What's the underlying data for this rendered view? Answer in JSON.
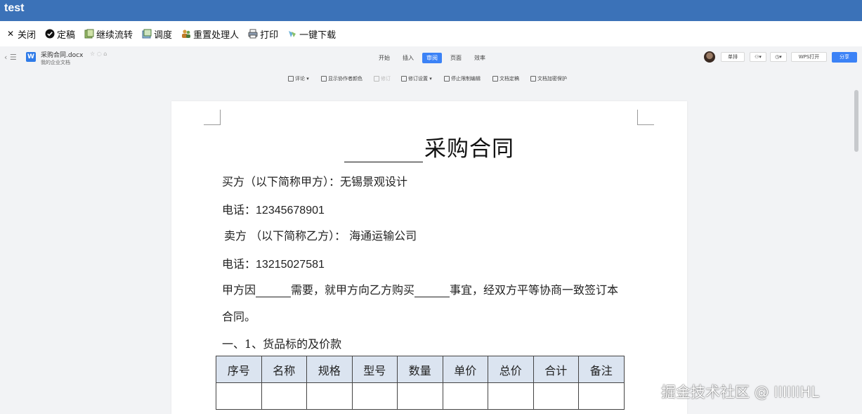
{
  "app": {
    "title": "test"
  },
  "toolbar": {
    "close": "关闭",
    "finalize": "定稿",
    "continue_flow": "继续流转",
    "dispatch": "调度",
    "reassign": "重置处理人",
    "print": "打印",
    "download": "一键下载"
  },
  "doc": {
    "filename": "采购合同.docx",
    "location": "我的企业文档",
    "tabs": [
      "开始",
      "插入",
      "审阅",
      "页面",
      "效率"
    ],
    "active_tab": "审阅",
    "right": {
      "collab": "单排",
      "open_wps": "WPS打开",
      "share": "分享"
    }
  },
  "review_bar": {
    "comment": "评论",
    "show_authors": "显示协作者颜色",
    "revise": "修订",
    "revision_settings": "修订设置",
    "stop_restrict": "停止限制编辑",
    "finalize_doc": "文档定稿",
    "protect": "文档加密保护"
  },
  "contract": {
    "title": "采购合同",
    "buyer": "买方（以下简称甲方）：无锡景观设计",
    "buyer_phone_label": "电话：",
    "buyer_phone": "12345678901",
    "seller": "卖方 （以下简称乙方）： 海通运输公司",
    "seller_phone_label": "电话：",
    "seller_phone": "13215027581",
    "para_a": "甲方因",
    "para_b": "需要，就甲方向乙方购买",
    "para_c": "事宜，经双方平等协商一致签订本",
    "para_end": "合同。",
    "section1": "一、1、货品标的及价款",
    "table_headers": [
      "序号",
      "名称",
      "规格",
      "型号",
      "数量",
      "单价",
      "总价",
      "合计",
      "备注"
    ]
  },
  "watermark": "掘金技术社区 @ IIIIIIHL"
}
